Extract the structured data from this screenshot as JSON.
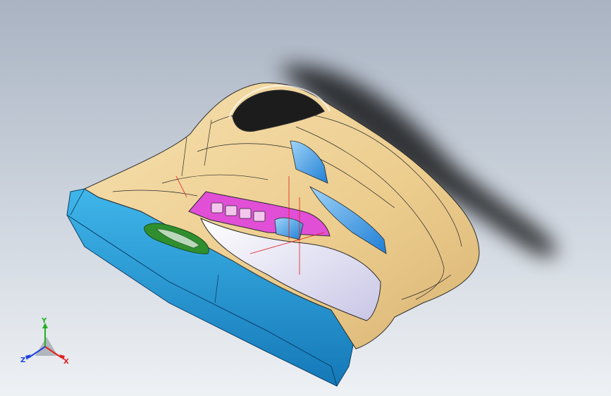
{
  "viewport": {
    "background_top": "#a9b3c2",
    "background_bottom": "#eef1f4"
  },
  "model": {
    "body_color": "#f0d49a",
    "edge_color": "#2a2a2a",
    "base_color": "#1a9fd8",
    "pocket_color": "#2f8f2f",
    "panel_color": "#e04fd6",
    "cover_color": "#e8e6f4",
    "window_color": "#3f9be6",
    "speaker_color": "#1c1c1c"
  },
  "triad": {
    "y_label": "Y",
    "x_label": "X",
    "z_label": "Z",
    "x_color": "#e02020",
    "y_color": "#20b020",
    "z_color": "#2040e0"
  }
}
